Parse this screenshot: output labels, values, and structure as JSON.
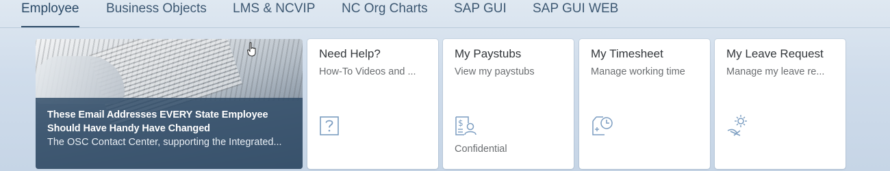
{
  "tabs": [
    {
      "label": "Employee",
      "active": true
    },
    {
      "label": "Business Objects"
    },
    {
      "label": "LMS & NCVIP"
    },
    {
      "label": "NC Org Charts"
    },
    {
      "label": "SAP GUI"
    },
    {
      "label": "SAP GUI WEB"
    }
  ],
  "news": {
    "headline": "These Email Addresses EVERY State Employee Should Have Handy Have Changed",
    "summary": "The OSC Contact Center, supporting the Integrated..."
  },
  "tiles": {
    "help": {
      "title": "Need Help?",
      "subtitle": "How-To Videos and ...",
      "icon": "question-icon"
    },
    "paystubs": {
      "title": "My Paystubs",
      "subtitle": "View my paystubs",
      "footer": "Confidential",
      "icon": "paystub-person-icon"
    },
    "timesheet": {
      "title": "My Timesheet",
      "subtitle": "Manage working time",
      "icon": "timesheet-clock-icon"
    },
    "leave": {
      "title": "My Leave Request",
      "subtitle": "Manage my leave re...",
      "icon": "beach-sun-icon"
    }
  },
  "colors": {
    "accent": "#2d4a66",
    "icon": "#7a9cc0",
    "overlay": "#2c4864"
  }
}
